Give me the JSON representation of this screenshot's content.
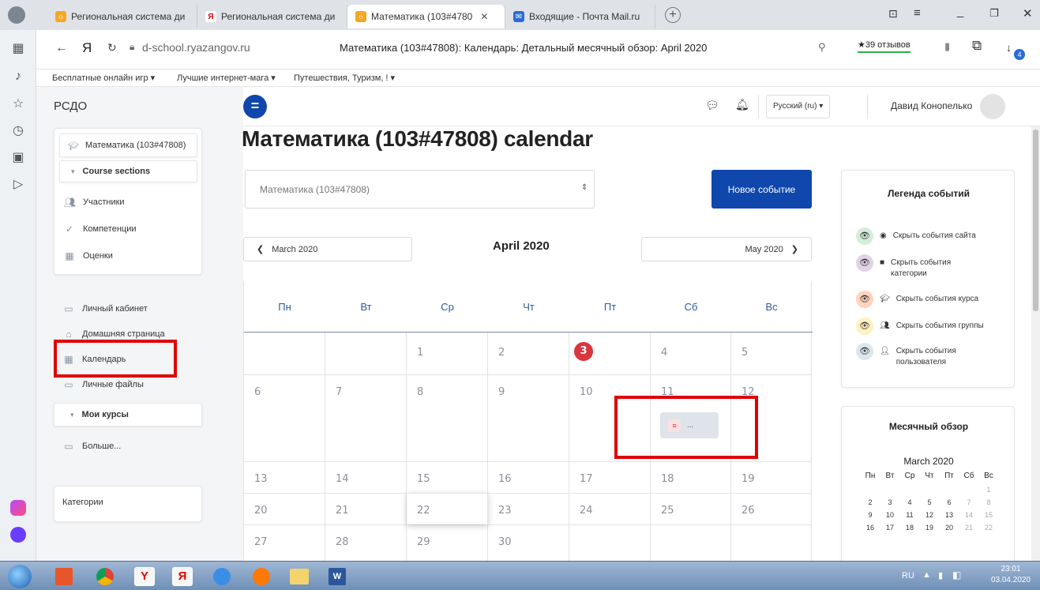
{
  "browser": {
    "tabs": [
      {
        "title": "Региональная система ди",
        "icon": "moodle-icon"
      },
      {
        "title": "Региональная система ди",
        "icon": "yandex-icon"
      },
      {
        "title": "Математика (103#4780",
        "icon": "moodle-icon",
        "active": true
      },
      {
        "title": "Входящие - Почта Mail.ru",
        "icon": "mail-icon"
      }
    ],
    "address": "d-school.ryazangov.ru",
    "page_title": "Математика (103#47808): Календарь: Детальный месячный обзор: April 2020",
    "reviews": "★39 отзывов",
    "bookmarks": [
      "Бесплатные онлайн игр ▾",
      "Лучшие интернет-мага ▾",
      "Путешествия, Туризм, ! ▾"
    ],
    "download_badge": "4"
  },
  "site": {
    "name": "РСДО",
    "language": "Русский (ru) ▾",
    "user": "Давид Конопелько"
  },
  "sidebar": {
    "course": "Математика (103#47808)",
    "course_sections": "Course sections",
    "items1": [
      "Участники",
      "Компетенции",
      "Оценки"
    ],
    "items2": [
      "Личный кабинет",
      "Домашняя страница",
      "Календарь",
      "Личные файлы"
    ],
    "my_courses": "Мои курсы",
    "more": "Больше...",
    "categories": "Категории"
  },
  "calendar": {
    "title": "Математика (103#47808) calendar",
    "course_select": "Математика (103#47808)",
    "new_event": "Новое событие",
    "prev_month": "March 2020",
    "current_month": "April 2020",
    "next_month": "May 2020",
    "weekdays": [
      "Пн",
      "Вт",
      "Ср",
      "Чт",
      "Пт",
      "Сб",
      "Вс"
    ],
    "week1": [
      "",
      "",
      "1",
      "2",
      "3",
      "4",
      "5"
    ],
    "week2": [
      "6",
      "7",
      "8",
      "9",
      "10",
      "11",
      "12"
    ],
    "week3": [
      "13",
      "14",
      "15",
      "16",
      "17",
      "18",
      "19"
    ],
    "week4": [
      "20",
      "21",
      "22",
      "23",
      "24",
      "25",
      "26"
    ],
    "week5": [
      "27",
      "28",
      "29",
      "30",
      "",
      "",
      ""
    ],
    "today": "3",
    "event_label": "..."
  },
  "legend": {
    "title": "Легенда событий",
    "site": "Скрыть события сайта",
    "category": "Скрыть события категории",
    "course": "Скрыть события курса",
    "group": "Скрыть события группы",
    "user": "Скрыть события пользователя",
    "colors": {
      "site": "#d4edda",
      "category": "#e1d3e6",
      "course": "#ffd3bd",
      "group": "#fff0c2",
      "user": "#dce7ec"
    }
  },
  "mini_month": {
    "title": "Месячный обзор",
    "month": "March 2020",
    "weekdays": [
      "Пн",
      "Вт",
      "Ср",
      "Чт",
      "Пт",
      "Сб",
      "Вс"
    ],
    "rows": [
      [
        "",
        "",
        "",
        "",
        "",
        "",
        "1"
      ],
      [
        "2",
        "3",
        "4",
        "5",
        "6",
        "7",
        "8"
      ],
      [
        "9",
        "10",
        "11",
        "12",
        "13",
        "14",
        "15"
      ],
      [
        "16",
        "17",
        "18",
        "19",
        "20",
        "21",
        "22"
      ]
    ]
  },
  "taskbar": {
    "lang": "RU",
    "time": "23:01",
    "date": "03.04.2020"
  },
  "colors": {
    "brand": "#0f47ad",
    "highlight": "#e00000",
    "today": "#d9373d"
  }
}
